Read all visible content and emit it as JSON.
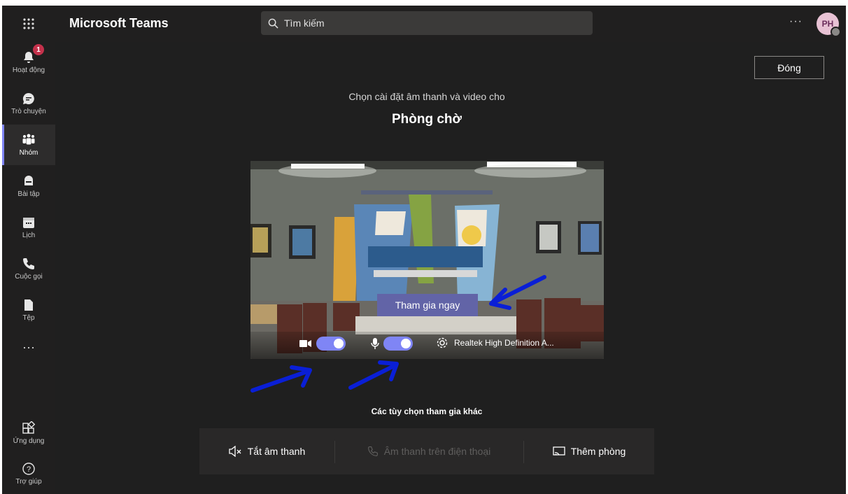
{
  "app": {
    "title": "Microsoft Teams",
    "search_placeholder": "Tìm kiếm",
    "more_label": "···",
    "avatar_initials": "PH"
  },
  "rail": {
    "items": [
      {
        "label": "Hoạt động",
        "icon": "bell-icon",
        "badge": "1"
      },
      {
        "label": "Trò chuyện",
        "icon": "chat-icon"
      },
      {
        "label": "Nhóm",
        "icon": "teams-icon",
        "active": true
      },
      {
        "label": "Bài tập",
        "icon": "assignments-icon"
      },
      {
        "label": "Lịch",
        "icon": "calendar-icon"
      },
      {
        "label": "Cuộc gọi",
        "icon": "phone-icon"
      },
      {
        "label": "Tệp",
        "icon": "file-icon"
      },
      {
        "label": "Ứng dụng",
        "icon": "apps-icon"
      },
      {
        "label": "Trợ giúp",
        "icon": "help-icon"
      }
    ],
    "more_label": "···"
  },
  "prejoin": {
    "close_label": "Đóng",
    "subtitle": "Chọn cài đặt âm thanh và video cho",
    "meeting_name": "Phòng chờ",
    "join_label": "Tham gia ngay",
    "video_on": true,
    "mic_on": true,
    "audio_device": "Realtek High Definition A..."
  },
  "other_options": {
    "title": "Các tùy chọn tham gia khác",
    "items": [
      {
        "label": "Tắt âm thanh",
        "icon": "speaker-off-icon",
        "enabled": true
      },
      {
        "label": "Âm thanh trên điện thoại",
        "icon": "phone-audio-icon",
        "enabled": false
      },
      {
        "label": "Thêm phòng",
        "icon": "cast-icon",
        "enabled": true
      }
    ]
  },
  "colors": {
    "accent": "#6264a7",
    "toggle_on": "#7f85f5",
    "background": "#1f1f1f",
    "annotation_arrow": "#0a1fd6"
  }
}
